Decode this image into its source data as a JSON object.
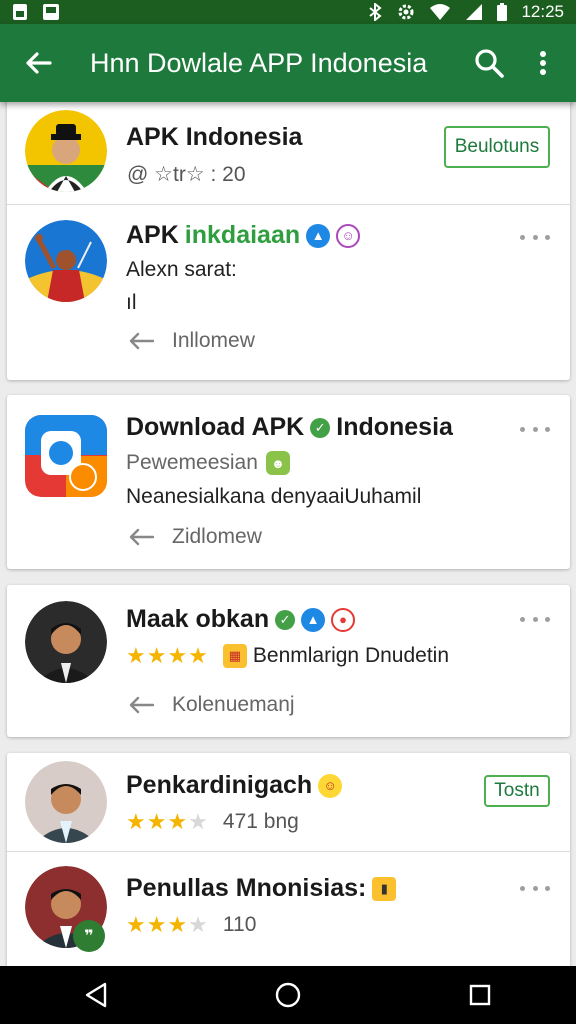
{
  "status_bar": {
    "time": "12:25",
    "icons": [
      "sim-icon",
      "gallery-icon",
      "bluetooth-icon",
      "settings-icon",
      "wifi-icon",
      "signal-icon",
      "battery-icon"
    ]
  },
  "app_bar": {
    "title": "Hnn Dowlale APP Indonesia",
    "back_icon": "arrow-back-icon",
    "search_icon": "search-icon",
    "menu_icon": "more-vert-icon"
  },
  "colors": {
    "status_bar": "#1b5e20",
    "app_bar": "#1e7a3c",
    "accent_green": "#2e9e3f",
    "star": "#f4b400"
  },
  "cards": [
    {
      "items": [
        {
          "name": "APK Indonesia",
          "meta": "@ ☆tr☆ : 20",
          "button": "Beulotuns"
        },
        {
          "name_prefix": "APK",
          "name_highlight": "inkdaiaan",
          "line1": "Alexn sarat:",
          "line2": "ıl",
          "follow": "Inllomew"
        }
      ]
    },
    {
      "items": [
        {
          "name": "Download APK",
          "name_suffix": "Indonesia",
          "line1": "Pewemeesian",
          "line2": "Neanesialkana denyaaiUuhamil",
          "follow": "Zidlomew"
        }
      ]
    },
    {
      "items": [
        {
          "name": "Maak obkan",
          "rating": 4,
          "rating_text": "Benmlarign Dnudetin",
          "follow": "Kolenuemanj"
        }
      ]
    },
    {
      "items": [
        {
          "name": "Penkardinigach",
          "rating": 3.5,
          "meta": "471 bng",
          "button": "Tostn"
        },
        {
          "name": "Penullas Mnonisias:",
          "rating": 3.5,
          "meta": "110"
        }
      ]
    }
  ],
  "nav_bar": {
    "back": "nav-back-icon",
    "home": "nav-home-icon",
    "recents": "nav-recents-icon"
  }
}
